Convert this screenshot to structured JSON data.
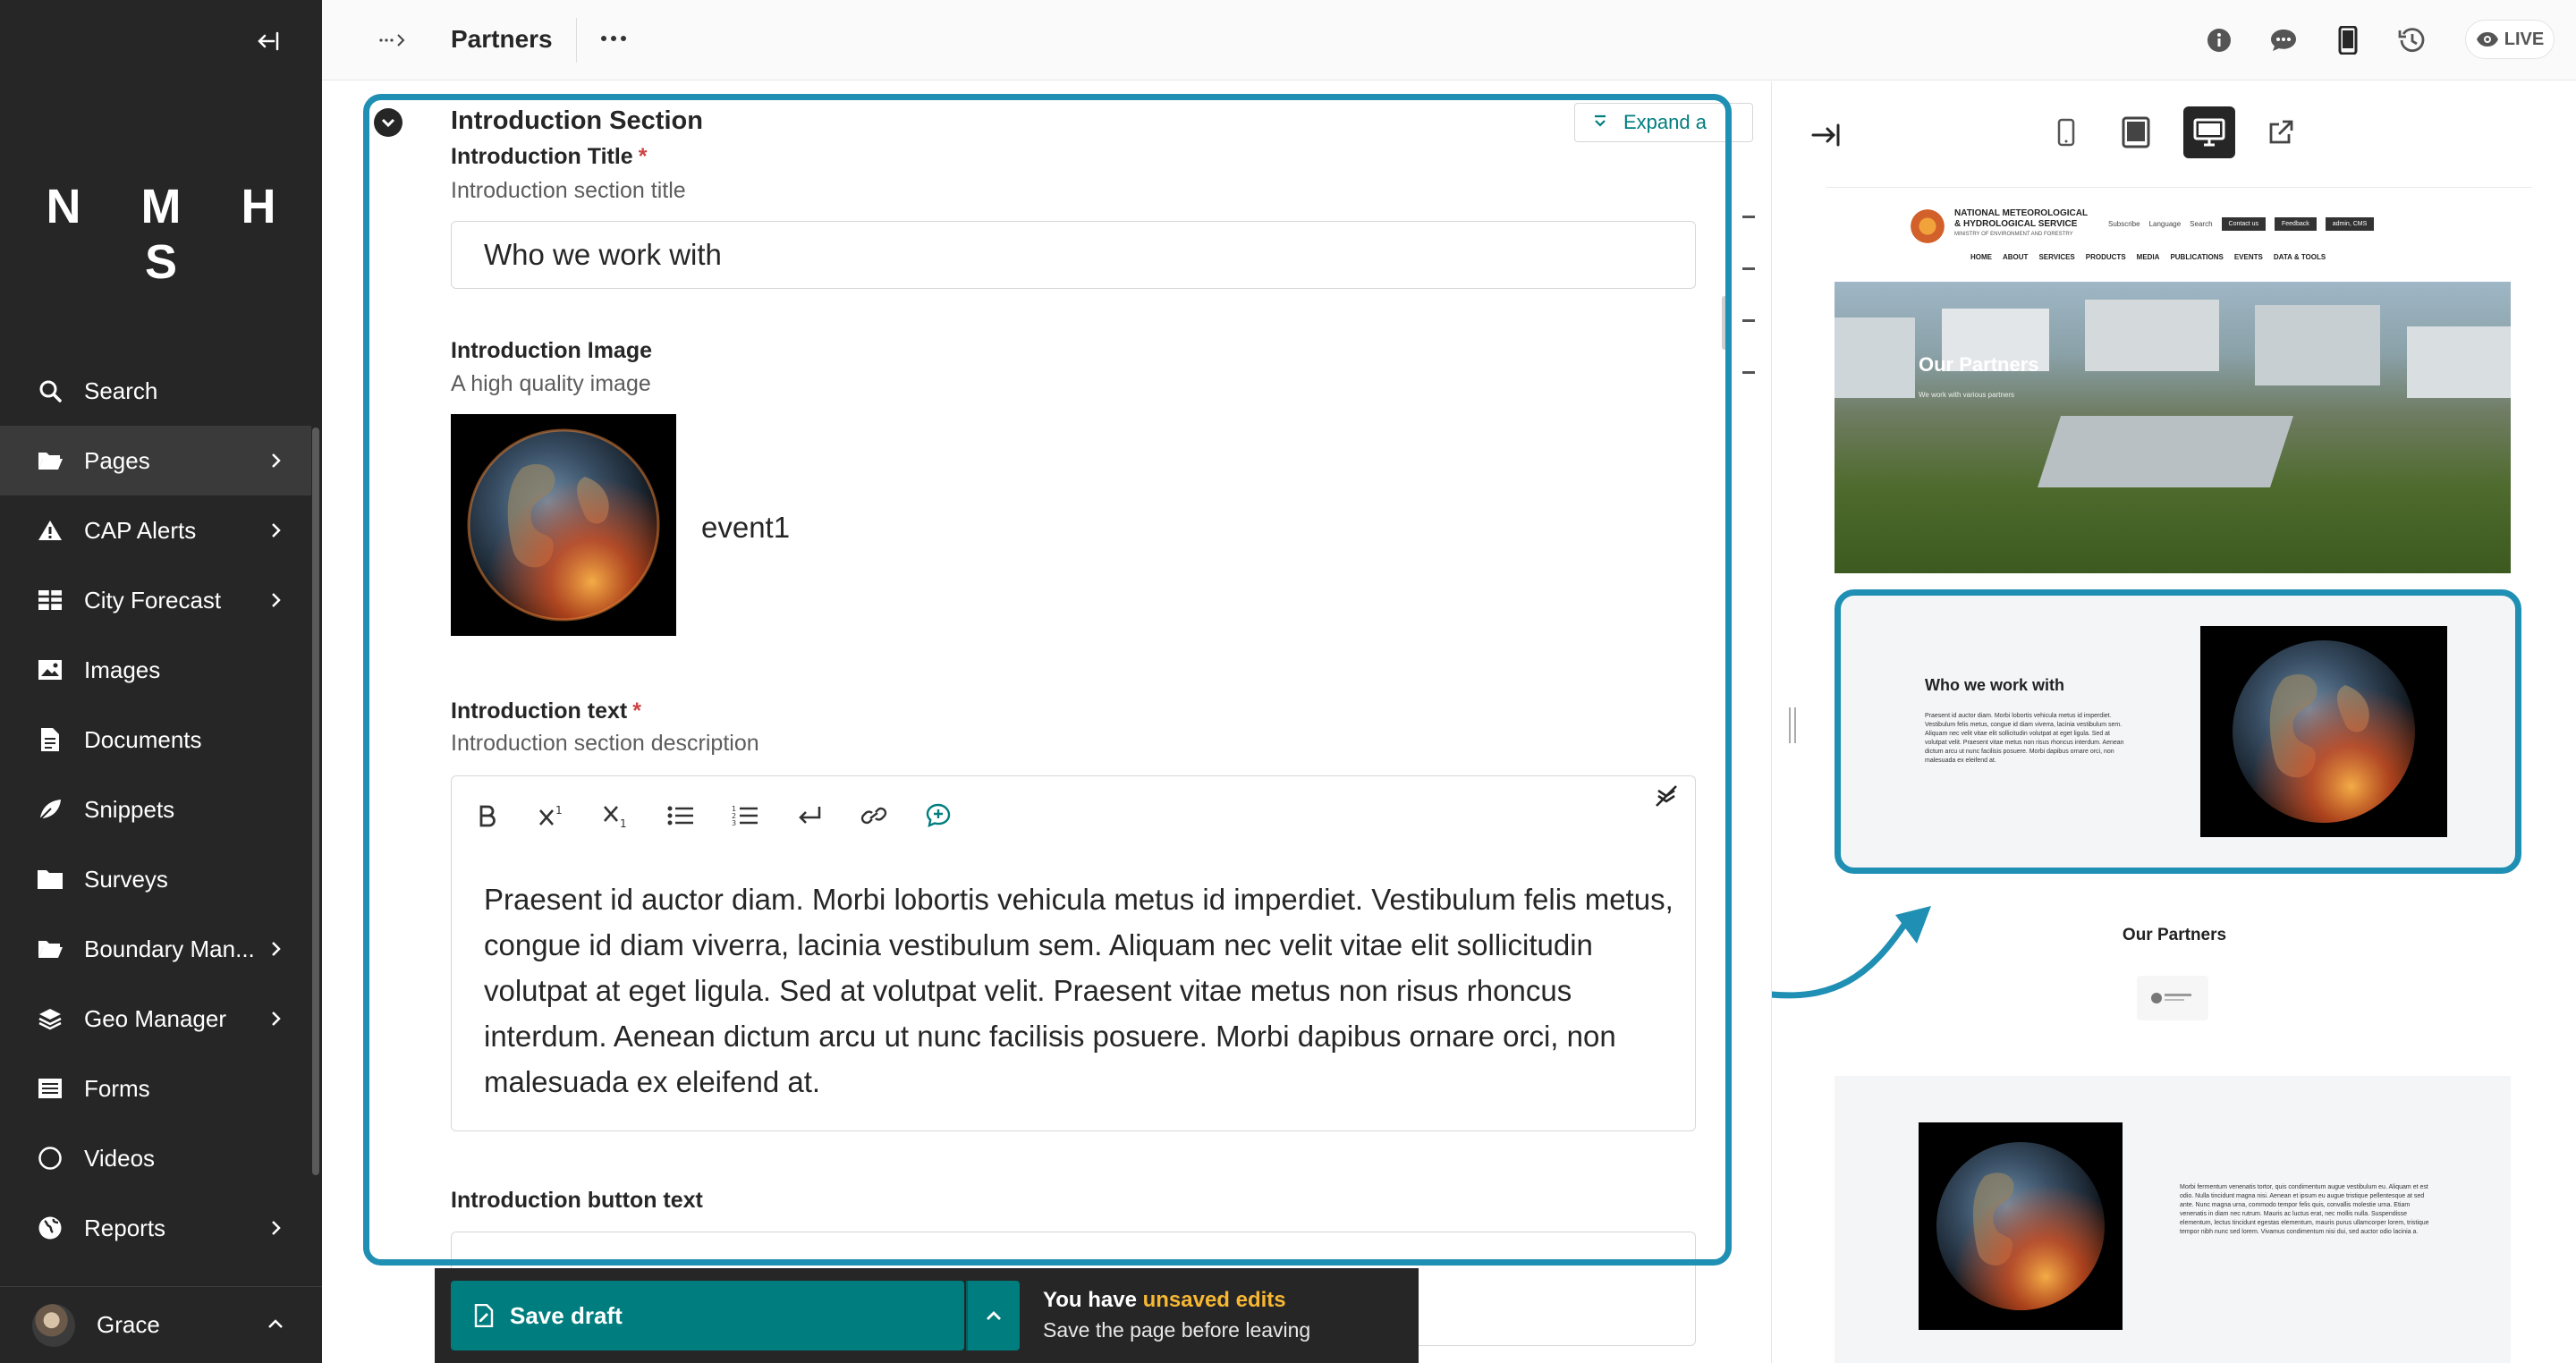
{
  "sidebar": {
    "logo": "N M H S",
    "items": [
      {
        "label": "Search",
        "icon": "search-icon",
        "has_children": false
      },
      {
        "label": "Pages",
        "icon": "folder-open-icon",
        "has_children": true
      },
      {
        "label": "CAP Alerts",
        "icon": "warning-icon",
        "has_children": true
      },
      {
        "label": "City Forecast",
        "icon": "table-icon",
        "has_children": true
      },
      {
        "label": "Images",
        "icon": "image-icon",
        "has_children": false
      },
      {
        "label": "Documents",
        "icon": "document-icon",
        "has_children": false
      },
      {
        "label": "Snippets",
        "icon": "snippet-icon",
        "has_children": false
      },
      {
        "label": "Surveys",
        "icon": "folder-icon",
        "has_children": false
      },
      {
        "label": "Boundary Man...",
        "icon": "folder-open-icon",
        "has_children": true
      },
      {
        "label": "Geo Manager",
        "icon": "layers-icon",
        "has_children": true
      },
      {
        "label": "Forms",
        "icon": "list-icon",
        "has_children": false
      },
      {
        "label": "Videos",
        "icon": "circle-icon",
        "has_children": false
      },
      {
        "label": "Reports",
        "icon": "globe-icon",
        "has_children": true
      }
    ],
    "user": "Grace"
  },
  "header": {
    "title": "Partners",
    "live_label": "LIVE"
  },
  "editor": {
    "section_title": "Introduction Section",
    "expand_label": "Expand a",
    "intro_title": {
      "label": "Introduction Title",
      "required": "*",
      "help": "Introduction section title",
      "value": "Who we work with"
    },
    "intro_image": {
      "label": "Introduction Image",
      "help": "A high quality image",
      "filename": "event1"
    },
    "intro_text": {
      "label": "Introduction text",
      "required": "*",
      "help": "Introduction section description",
      "toolbar": [
        "bold",
        "superscript",
        "subscript",
        "bulleted-list",
        "numbered-list",
        "line-break",
        "link",
        "comment"
      ],
      "value": "Praesent id auctor diam. Morbi lobortis vehicula metus id imperdiet. Vestibulum felis metus, congue id diam viverra, lacinia vestibulum sem. Aliquam nec velit vitae elit sollicitudin volutpat at eget ligula. Sed at volutpat velit. Praesent vitae metus non risus rhoncus interdum. Aenean dictum arcu ut nunc facilisis posuere. Morbi dapibus ornare orci, non malesuada ex eleifend at."
    },
    "intro_button": {
      "label": "Introduction button text"
    }
  },
  "savebar": {
    "save_label": "Save draft",
    "message_prefix": "You have ",
    "message_highlight": "unsaved edits",
    "message_sub": "Save the page before leaving"
  },
  "preview": {
    "site": {
      "name": "NATIONAL METEOROLOGICAL & HYDROLOGICAL SERVICE",
      "tagline": "MINISTRY OF ENVIRONMENT AND FORESTRY",
      "util": [
        "Subscribe",
        "Language",
        "Search"
      ],
      "buttons": [
        "Contact us",
        "Feedback",
        "admin, CMS"
      ],
      "nav": [
        "HOME",
        "ABOUT",
        "SERVICES",
        "PRODUCTS",
        "MEDIA",
        "PUBLICATIONS",
        "EVENTS",
        "DATA & TOOLS"
      ]
    },
    "hero_title": "Our Partners",
    "hero_sub": "We work with various partners",
    "intro_title": "Who we work with",
    "intro_text": "Praesent id auctor diam. Morbi lobortis vehicula metus id imperdiet. Vestibulum felis metus, congue id diam viverra, lacinia vestibulum sem. Aliquam nec velit vitae elit sollicitudin volutpat at eget ligula. Sed at volutpat velit. Praesent vitae metus non risus rhoncus interdum. Aenean dictum arcu ut nunc facilisis posuere. Morbi dapibus ornare orci, non malesuada ex eleifend at.",
    "partners_title": "Our Partners",
    "lower_text": "Morbi fermentum venenatis tortor, quis condimentum augue vestibulum eu. Aliquam et est odio. Nulla tincidunt magna nisi. Aenean et ipsum eu augue tristique pellentesque at sed ante. Nunc magna urna, commodo tempor felis quis, convallis molestie urna. Etiam venenatis in diam nec rutrum. Mauris ac luctus erat, nec mollis nulla. Suspendisse elementum, lectus tincidunt egestas elementum, mauris purus ullamcorper lorem, tristique tempor nibh nunc sed lorem. Vivamus condimentum nisi dui, sed auctor odio lacinia a."
  },
  "colors": {
    "sidebar": "#262626",
    "accent": "#007d7e",
    "highlight": "#1f8fb3",
    "warning": "#f7b733",
    "required": "#cd4444"
  }
}
